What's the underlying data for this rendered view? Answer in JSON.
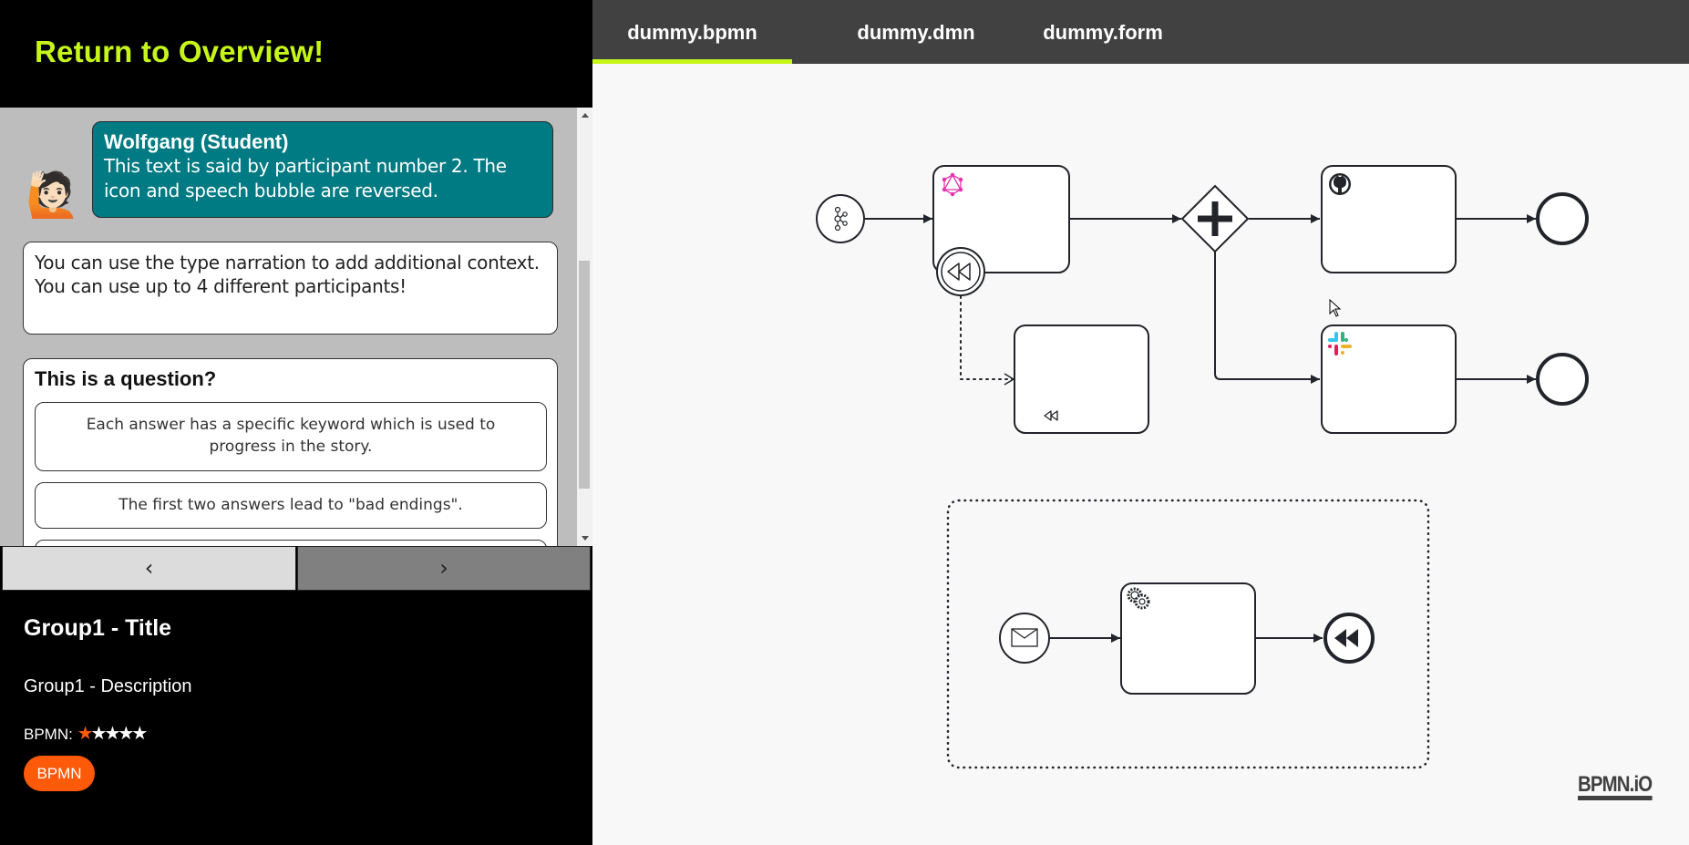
{
  "sidebar": {
    "return_link": "Return to Overview!",
    "chat": {
      "speaker_avatar": "🙋🏻",
      "speaker_avatar_name": "person-raising-hand-icon",
      "speaker_name": "Wolfgang (Student)",
      "speech": "This text is said by participant number 2. The icon and speech bubble are reversed.",
      "narration": "You can use the type narration to add additional context. You can use up to 4 different participants!",
      "question": {
        "title": "This is a question?",
        "answers": [
          "Each answer has a specific keyword which is used to progress in the story.",
          "The first two answers lead to \"bad endings\".",
          ""
        ]
      },
      "bubble_color": "#007b83"
    },
    "nav": {
      "prev_label": "‹",
      "next_label": "›"
    },
    "group": {
      "title": "Group1 - Title",
      "description": "Group1 - Description",
      "rating_label": "BPMN:",
      "rating": {
        "value": 1,
        "max": 5
      },
      "badge": "BPMN",
      "accent_color": "#ff5a0a"
    }
  },
  "tabs": {
    "items": [
      {
        "label": "dummy.bpmn",
        "active": true
      },
      {
        "label": "dummy.dmn",
        "active": false
      },
      {
        "label": "dummy.form",
        "active": false
      }
    ],
    "active_color": "#c6f51a"
  },
  "diagram": {
    "elements": [
      {
        "id": "start-event",
        "type": "startEvent",
        "marker": "kafka-icon"
      },
      {
        "id": "task-graphql",
        "type": "task",
        "marker": "graphql-icon"
      },
      {
        "id": "boundary-compensation",
        "type": "boundaryEvent",
        "marker": "compensation-icon"
      },
      {
        "id": "compensation-task",
        "type": "task",
        "marker": "compensation-icon"
      },
      {
        "id": "parallel-gateway",
        "type": "parallelGateway",
        "marker": "plus-icon"
      },
      {
        "id": "task-github",
        "type": "task",
        "marker": "github-icon"
      },
      {
        "id": "task-slack",
        "type": "task",
        "marker": "slack-icon"
      },
      {
        "id": "end-event-1",
        "type": "endEvent"
      },
      {
        "id": "end-event-2",
        "type": "endEvent"
      },
      {
        "id": "event-subprocess",
        "type": "eventSubProcess"
      },
      {
        "id": "message-start-event",
        "type": "startEvent",
        "marker": "envelope-icon"
      },
      {
        "id": "service-task",
        "type": "serviceTask",
        "marker": "gear-icon"
      },
      {
        "id": "compensation-end-event",
        "type": "endEvent",
        "marker": "compensation-icon"
      }
    ]
  },
  "footer": {
    "logo": "BPMN.iO"
  }
}
